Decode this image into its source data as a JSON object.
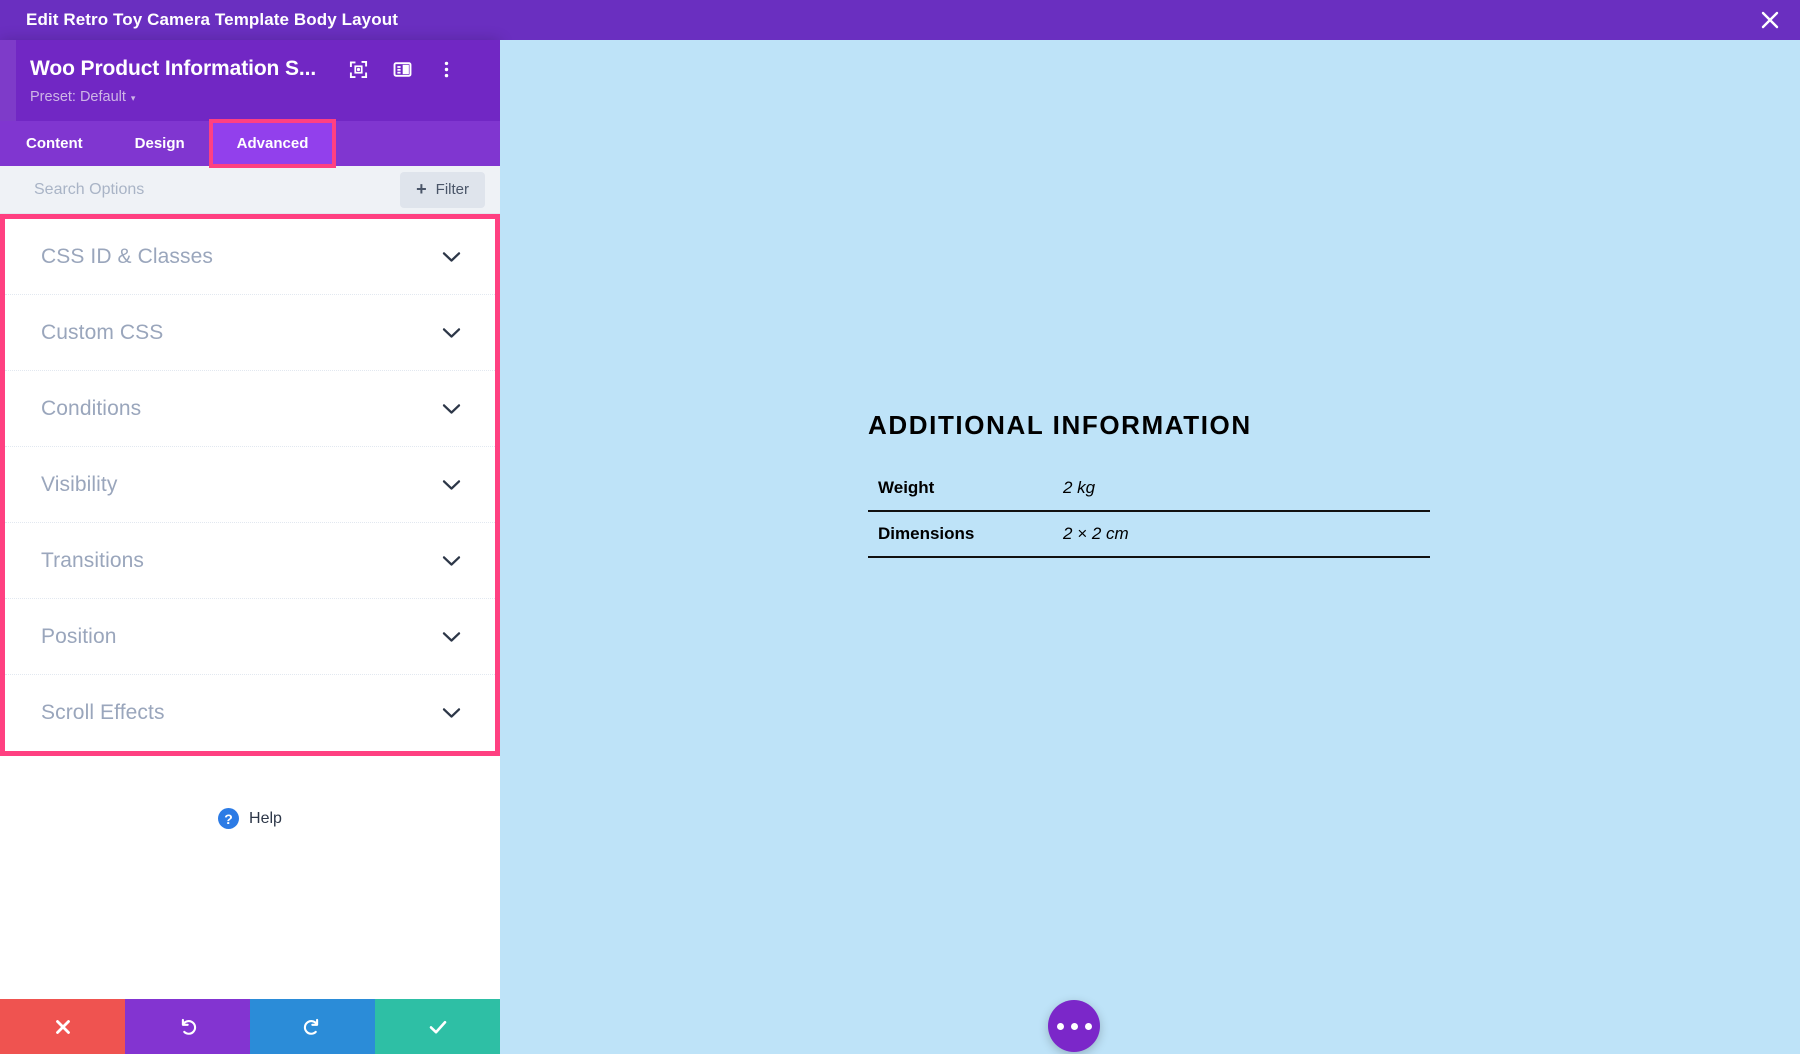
{
  "topbar": {
    "title": "Edit Retro Toy Camera Template Body Layout",
    "close_icon": "close-icon",
    "bg_color": "#6A2FC0"
  },
  "panel": {
    "module_title": "Woo Product Information S...",
    "preset_label": "Preset: Default",
    "preset_caret": "▾",
    "header_icons": [
      {
        "name": "focus-target-icon",
        "title": "Focus"
      },
      {
        "name": "layout-panel-icon",
        "title": "Panel Layout"
      },
      {
        "name": "more-vertical-icon",
        "title": "More Options"
      }
    ],
    "tabs": [
      {
        "label": "Content",
        "active": false,
        "highlighted": false
      },
      {
        "label": "Design",
        "active": false,
        "highlighted": false
      },
      {
        "label": "Advanced",
        "active": true,
        "highlighted": true
      }
    ],
    "search": {
      "placeholder": "Search Options",
      "value": ""
    },
    "filter_button": {
      "label": "Filter",
      "plus": "+"
    },
    "accordion_highlight_color": "#FF4081",
    "accordion_items": [
      {
        "label": "CSS ID & Classes",
        "chevron": "chevron-down-icon"
      },
      {
        "label": "Custom CSS",
        "chevron": "chevron-down-icon"
      },
      {
        "label": "Conditions",
        "chevron": "chevron-down-icon"
      },
      {
        "label": "Visibility",
        "chevron": "chevron-down-icon"
      },
      {
        "label": "Transitions",
        "chevron": "chevron-down-icon"
      },
      {
        "label": "Position",
        "chevron": "chevron-down-icon"
      },
      {
        "label": "Scroll Effects",
        "chevron": "chevron-down-icon"
      }
    ],
    "help": {
      "label": "Help",
      "icon_glyph": "?"
    },
    "actions": [
      {
        "name": "cancel",
        "icon": "close-icon",
        "color": "#EF5350"
      },
      {
        "name": "undo",
        "icon": "undo-icon",
        "color": "#8334D1"
      },
      {
        "name": "redo",
        "icon": "redo-icon",
        "color": "#2B8CD8"
      },
      {
        "name": "save",
        "icon": "check-icon",
        "color": "#2EBFA5"
      }
    ]
  },
  "content": {
    "background_color": "#BEE3F8",
    "product_info": {
      "title": "ADDITIONAL INFORMATION",
      "rows": [
        {
          "key": "Weight",
          "value": "2 kg"
        },
        {
          "key": "Dimensions",
          "value": "2 × 2 cm"
        }
      ]
    },
    "fab": {
      "name": "more-options-fab",
      "color": "#7B27C9"
    }
  }
}
